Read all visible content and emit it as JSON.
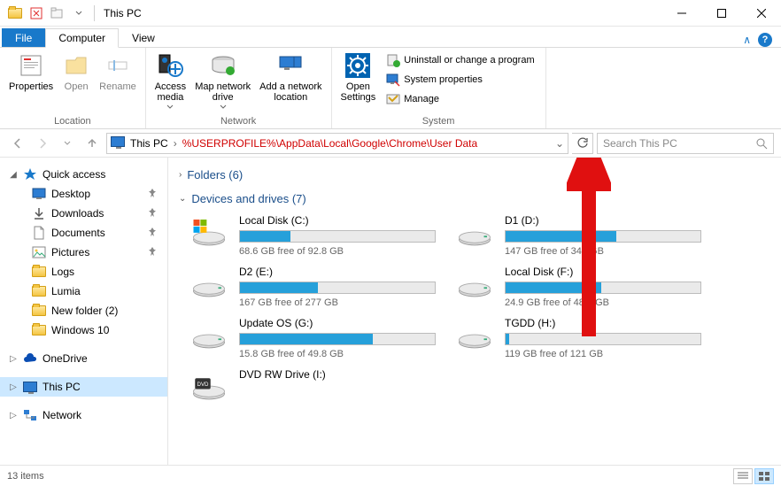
{
  "title": "This PC",
  "tabs": {
    "file": "File",
    "computer": "Computer",
    "view": "View"
  },
  "ribbon": {
    "location": {
      "label": "Location",
      "properties": "Properties",
      "open": "Open",
      "rename": "Rename"
    },
    "network": {
      "label": "Network",
      "access_media": "Access\nmedia",
      "map_drive": "Map network\ndrive",
      "add_location": "Add a network\nlocation"
    },
    "system": {
      "label": "System",
      "open_settings": "Open\nSettings",
      "uninstall": "Uninstall or change a program",
      "sys_props": "System properties",
      "manage": "Manage"
    }
  },
  "address": {
    "crumb": "This PC",
    "path": "%USERPROFILE%\\AppData\\Local\\Google\\Chrome\\User Data",
    "search_placeholder": "Search This PC"
  },
  "sidebar": {
    "quick_access": "Quick access",
    "items": [
      {
        "label": "Desktop",
        "icon": "desktop",
        "pinned": true
      },
      {
        "label": "Downloads",
        "icon": "downloads",
        "pinned": true
      },
      {
        "label": "Documents",
        "icon": "documents",
        "pinned": true
      },
      {
        "label": "Pictures",
        "icon": "pictures",
        "pinned": true
      },
      {
        "label": "Logs",
        "icon": "folder",
        "pinned": false
      },
      {
        "label": "Lumia",
        "icon": "folder",
        "pinned": false
      },
      {
        "label": "New folder (2)",
        "icon": "folder",
        "pinned": false
      },
      {
        "label": "Windows 10",
        "icon": "folder",
        "pinned": false
      }
    ],
    "onedrive": "OneDrive",
    "this_pc": "This PC",
    "network": "Network"
  },
  "sections": {
    "folders": "Folders (6)",
    "drives": "Devices and drives (7)"
  },
  "drives": [
    {
      "name": "Local Disk (C:)",
      "free": "68.6 GB free of 92.8 GB",
      "fill": 26,
      "icon": "os"
    },
    {
      "name": "D1 (D:)",
      "free": "147 GB free of 341 GB",
      "fill": 57,
      "icon": "hdd"
    },
    {
      "name": "D2 (E:)",
      "free": "167 GB free of 277 GB",
      "fill": 40,
      "icon": "hdd"
    },
    {
      "name": "Local Disk (F:)",
      "free": "24.9 GB free of 48.8 GB",
      "fill": 49,
      "icon": "hdd"
    },
    {
      "name": "Update OS (G:)",
      "free": "15.8 GB free of 49.8 GB",
      "fill": 68,
      "icon": "hdd"
    },
    {
      "name": "TGDD (H:)",
      "free": "119 GB free of 121 GB",
      "fill": 2,
      "icon": "hdd"
    },
    {
      "name": "DVD RW Drive (I:)",
      "free": "",
      "fill": -1,
      "icon": "dvd"
    }
  ],
  "status": {
    "count": "13 items"
  }
}
